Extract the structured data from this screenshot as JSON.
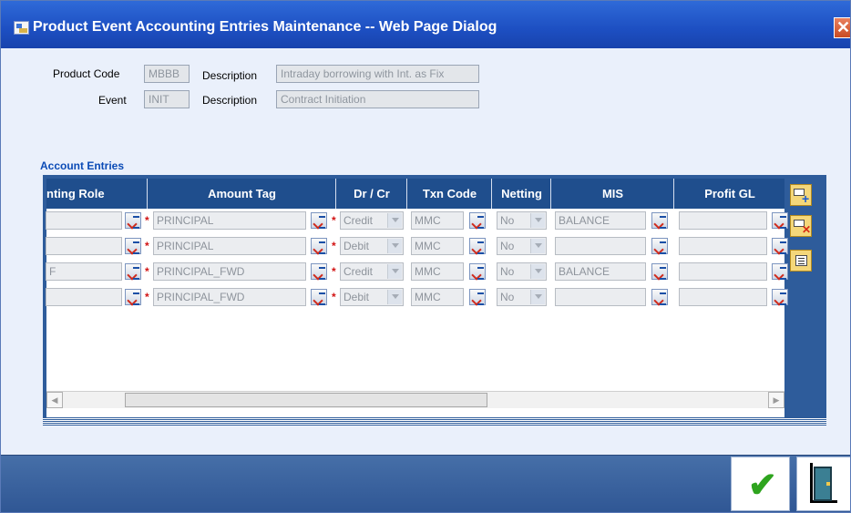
{
  "window": {
    "title": "Product Event Accounting Entries Maintenance -- Web Page Dialog",
    "close_glyph": "✕"
  },
  "form": {
    "product_code_label": "Product Code",
    "product_code": "MBBB",
    "description_label_1": "Description",
    "product_description": "Intraday borrowing with Int. as Fix",
    "event_label": "Event",
    "event": "INIT",
    "description_label_2": "Description",
    "event_description": "Contract Initiation"
  },
  "section": {
    "title": "Account Entries"
  },
  "grid": {
    "columns": [
      "nting Role",
      "Amount Tag",
      "Dr / Cr",
      "Txn Code",
      "Netting",
      "MIS",
      "Profit GL"
    ],
    "rows": [
      {
        "role": "",
        "amount_tag": "PRINCIPAL",
        "drcr": "Credit",
        "txn_code": "MMC",
        "netting": "No",
        "mis": "BALANCE",
        "profit_gl": ""
      },
      {
        "role": "",
        "amount_tag": "PRINCIPAL",
        "drcr": "Debit",
        "txn_code": "MMC",
        "netting": "No",
        "mis": "",
        "profit_gl": ""
      },
      {
        "role": "F",
        "amount_tag": "PRINCIPAL_FWD",
        "drcr": "Credit",
        "txn_code": "MMC",
        "netting": "No",
        "mis": "BALANCE",
        "profit_gl": ""
      },
      {
        "role": "",
        "amount_tag": "PRINCIPAL_FWD",
        "drcr": "Debit",
        "txn_code": "MMC",
        "netting": "No",
        "mis": "",
        "profit_gl": ""
      }
    ],
    "required_marker": "*"
  },
  "scrollbar": {
    "left_arrow": "◀",
    "right_arrow": "▶"
  },
  "toolbar": {
    "add_icon": "add-row-icon",
    "delete_icon": "delete-row-icon",
    "view_icon": "list-view-icon"
  },
  "footer": {
    "ok_glyph": "✔",
    "exit_icon": "exit-door-icon"
  }
}
